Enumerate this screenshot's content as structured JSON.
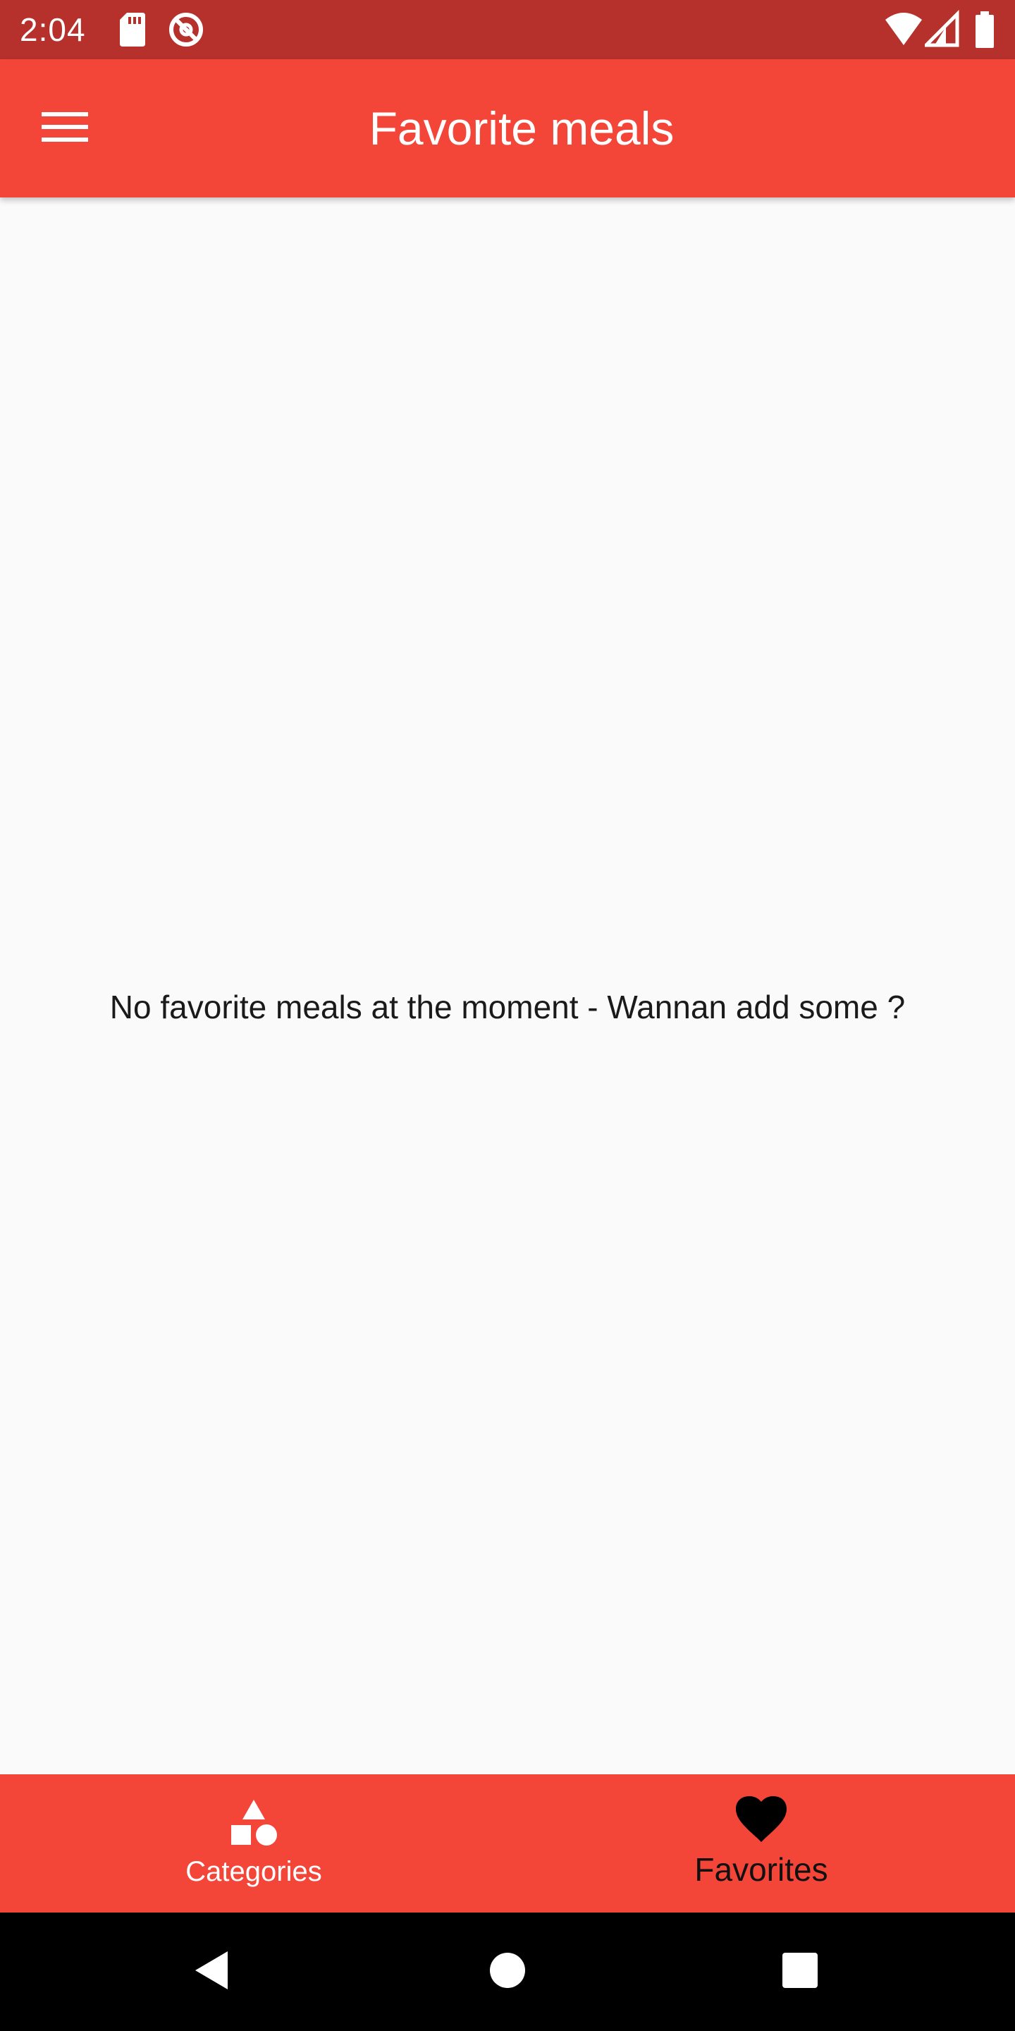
{
  "status_bar": {
    "time": "2:04",
    "icons": [
      "sd-card-icon",
      "do-not-disturb-icon",
      "wifi-icon",
      "cell-signal-icon",
      "battery-icon"
    ]
  },
  "app_bar": {
    "title": "Favorite meals",
    "menu_icon": "hamburger-menu-icon"
  },
  "main": {
    "empty_message": "No favorite meals at the moment - Wannan add some ?"
  },
  "bottom_nav": {
    "items": [
      {
        "label": "Categories",
        "icon": "categories-icon",
        "active": false
      },
      {
        "label": "Favorites",
        "icon": "heart-icon",
        "active": true
      }
    ]
  },
  "system_nav": {
    "icons": [
      "back-icon",
      "home-icon",
      "recents-icon"
    ]
  },
  "colors": {
    "status_bar": "#b7312c",
    "primary": "#f44539",
    "background": "#fafafa",
    "active_tab": "#111111",
    "inactive_tab": "#ffffff"
  }
}
